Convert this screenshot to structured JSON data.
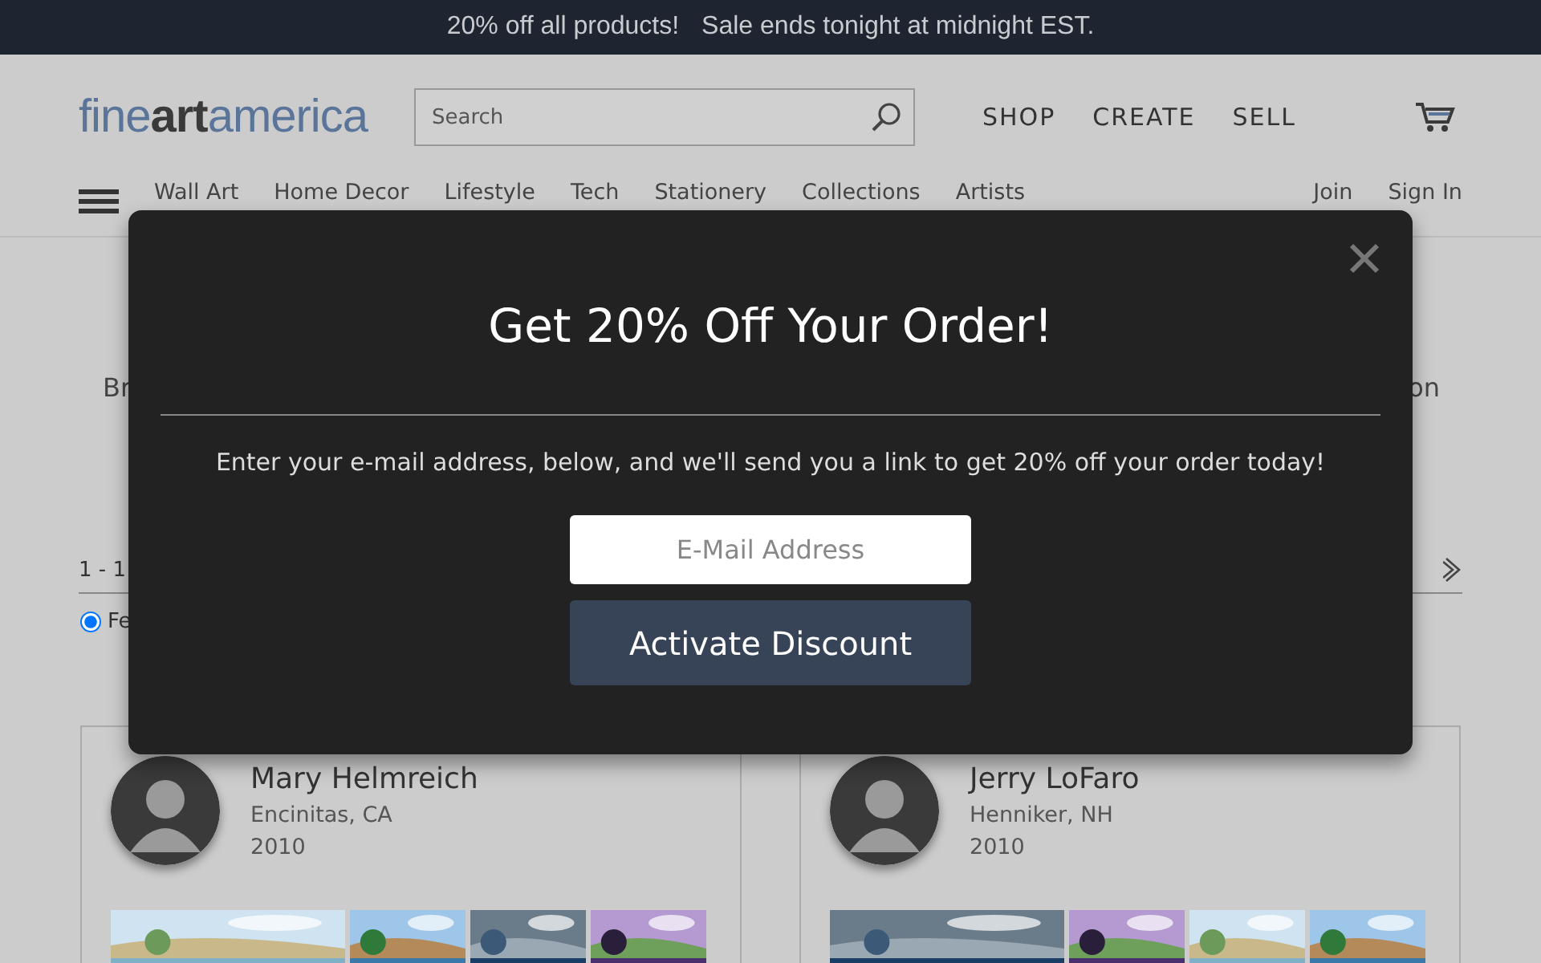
{
  "promo_bar": {
    "offer": "20% off all products!",
    "deadline": "Sale ends tonight at midnight EST."
  },
  "header": {
    "logo": "fine**art**america",
    "search": {
      "placeholder": "Search"
    },
    "nav_links": [
      "SHOP",
      "CREATE",
      "SELL"
    ],
    "categories": [
      "Wall Art",
      "Home Decor",
      "Lifestyle",
      "Tech",
      "Stationery",
      "Collections",
      "Artists"
    ],
    "account_links": [
      "Join",
      "Sign In"
    ]
  },
  "background": {
    "intro_left": "Br",
    "intro_right": "on",
    "results_count": "1 - 1",
    "sort_option": {
      "label": "Fe",
      "selected": true
    }
  },
  "artists": [
    {
      "name": "Mary Helmreich",
      "location": "Encinitas, CA",
      "year": "2010"
    },
    {
      "name": "Jerry LoFaro",
      "location": "Henniker, NH",
      "year": "2010"
    }
  ],
  "modal": {
    "title": "Get 20% Off Your Order!",
    "message": "Enter your e-mail address, below, and we'll send you a link to get 20% off your order today!",
    "email_placeholder": "E-Mail Address",
    "button": "Activate Discount"
  }
}
